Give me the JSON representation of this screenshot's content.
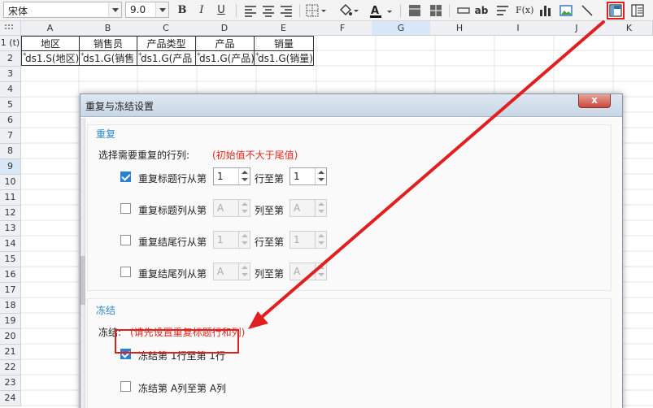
{
  "toolbar": {
    "font_name": "宋体",
    "font_size": "9.0",
    "bold": "B",
    "italic": "I",
    "underline": "U",
    "text_ab": "ab",
    "formula": "F(x)"
  },
  "columns": [
    "A",
    "B",
    "C",
    "D",
    "E",
    "F",
    "G",
    "H",
    "I",
    "J",
    "K"
  ],
  "selected_column": "G",
  "rows": [
    "1 (t)",
    "2",
    "3",
    "4",
    "5",
    "6",
    "7",
    "8",
    "9",
    "10",
    "11",
    "12",
    "13",
    "14",
    "15",
    "16",
    "17",
    "18",
    "19",
    "20",
    "21",
    "22",
    "23",
    "24"
  ],
  "selected_row": "9",
  "table": {
    "headers": [
      "地区",
      "销售员",
      "产品类型",
      "产品",
      "销量"
    ],
    "cells": [
      "ds1.S(地区)",
      "ds1.G(销售",
      "ds1.G(产品",
      "ds1.G(产品)",
      "ds1.G(销量)"
    ]
  },
  "dialog": {
    "title": "重复与冻结设置",
    "close": "x",
    "repeat": {
      "title": "重复",
      "prompt": "选择需要重复的行列:",
      "hint": "(初始值不大于尾值)",
      "rows": [
        {
          "label": "重复标题行从第",
          "from": "1",
          "to_label": "行至第",
          "to": "1",
          "checked": true,
          "enabled": true
        },
        {
          "label": "重复标题列从第",
          "from": "A",
          "to_label": "列至第",
          "to": "A",
          "checked": false,
          "enabled": false
        },
        {
          "label": "重复结尾行从第",
          "from": "1",
          "to_label": "行至第",
          "to": "1",
          "checked": false,
          "enabled": false
        },
        {
          "label": "重复结尾列从第",
          "from": "A",
          "to_label": "列至第",
          "to": "A",
          "checked": false,
          "enabled": false
        }
      ]
    },
    "freeze": {
      "title": "冻结",
      "prompt": "冻结:",
      "hint": "(请先设置重复标题行和列)",
      "option_rows": "冻结第 1行至第 1行",
      "option_cols": "冻结第 A列至第 A列"
    }
  },
  "colors": {
    "accent": "#2b7fd4",
    "annotation": "#e02020",
    "hint_red": "#e02a1d",
    "group_title": "#2f86c8"
  }
}
